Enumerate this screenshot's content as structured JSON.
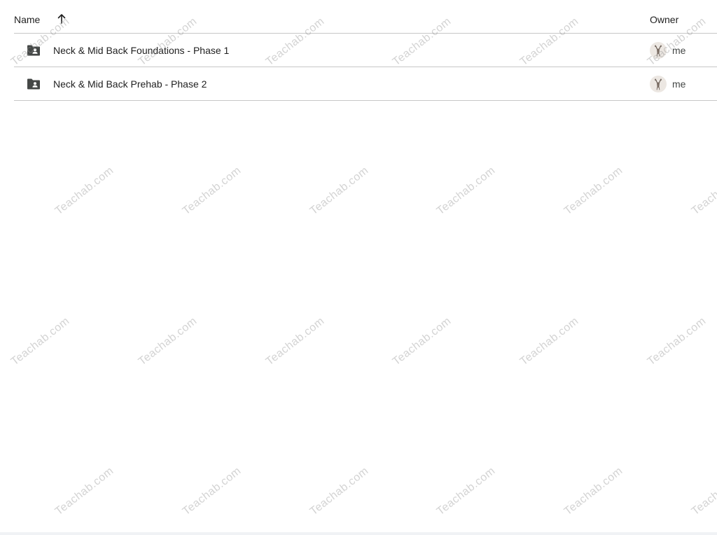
{
  "header": {
    "name_label": "Name",
    "owner_label": "Owner",
    "sort_icon": "arrow-upward-icon"
  },
  "rows": [
    {
      "name": "Neck & Mid Back Foundations - Phase 1",
      "icon": "shared-folder-icon",
      "owner": "me"
    },
    {
      "name": "Neck & Mid Back Prehab - Phase 2",
      "icon": "shared-folder-icon",
      "owner": "me"
    }
  ],
  "watermark": {
    "text": "Teachab.com"
  },
  "colors": {
    "text": "#1f1f1f",
    "divider": "#c7c7c7",
    "folder_icon": "#444746",
    "avatar_bg": "#ece7e2"
  }
}
